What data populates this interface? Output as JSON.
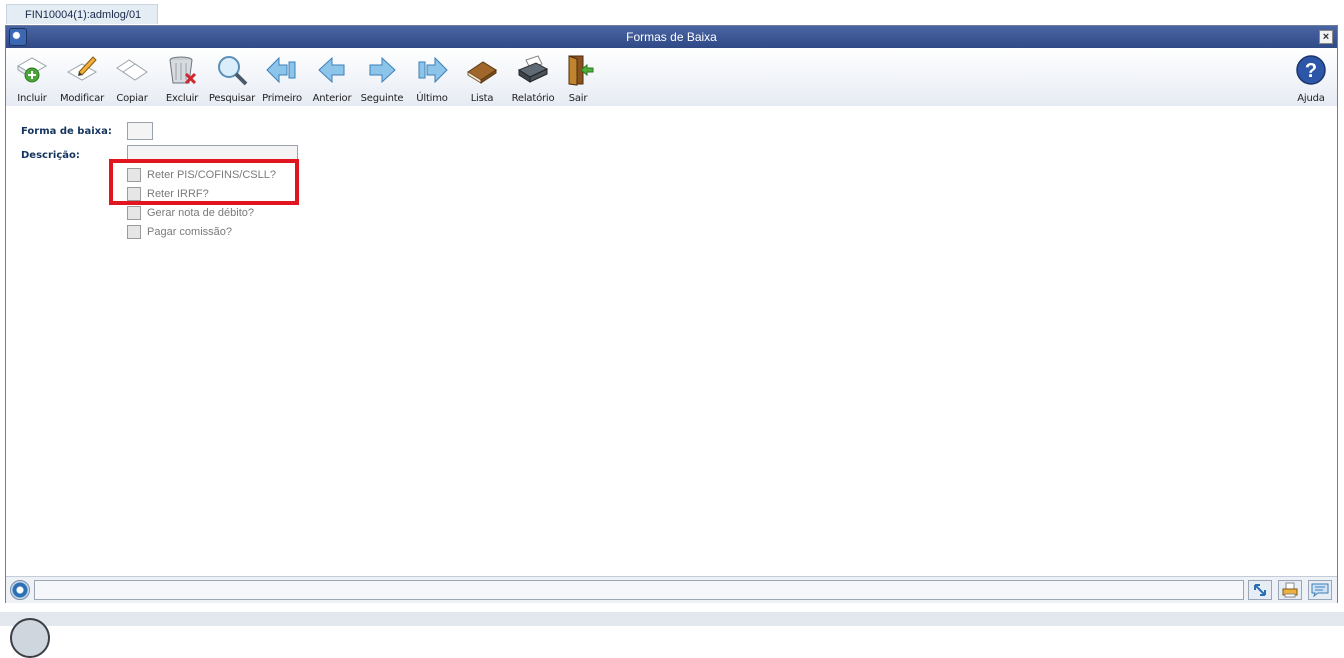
{
  "session_tab": {
    "label": "FIN10004(1):admlog/01"
  },
  "window": {
    "title": "Formas de Baixa",
    "close_label": "×"
  },
  "toolbar": {
    "buttons": [
      {
        "label": "Incluir",
        "icon": "add-document-icon"
      },
      {
        "label": "Modificar",
        "icon": "edit-pencil-icon"
      },
      {
        "label": "Copiar",
        "icon": "copy-icon"
      },
      {
        "label": "Excluir",
        "icon": "trash-delete-icon"
      },
      {
        "label": "Pesquisar",
        "icon": "magnifier-icon"
      },
      {
        "label": "Primeiro",
        "icon": "first-arrow-icon"
      },
      {
        "label": "Anterior",
        "icon": "previous-arrow-icon"
      },
      {
        "label": "Seguinte",
        "icon": "next-arrow-icon"
      },
      {
        "label": "Último",
        "icon": "last-arrow-icon"
      },
      {
        "label": "Lista",
        "icon": "book-list-icon"
      },
      {
        "label": "Relatório",
        "icon": "printer-icon"
      },
      {
        "label": "Sair",
        "icon": "exit-door-icon"
      }
    ],
    "help": {
      "label": "Ajuda",
      "icon": "help-icon"
    }
  },
  "form": {
    "forma_label": "Forma de baixa:",
    "forma_value": "",
    "descricao_label": "Descrição:",
    "descricao_value": "",
    "checkboxes": [
      {
        "label": "Reter PIS/COFINS/CSLL?",
        "checked": false
      },
      {
        "label": "Reter IRRF?",
        "checked": false
      },
      {
        "label": "Gerar nota de débito?",
        "checked": false
      },
      {
        "label": "Pagar comissão?",
        "checked": false
      }
    ]
  },
  "statusbar": {
    "message": ""
  },
  "colors": {
    "titlebar": "#2f4a86",
    "highlight": "#e0151f",
    "label": "#14335e"
  }
}
